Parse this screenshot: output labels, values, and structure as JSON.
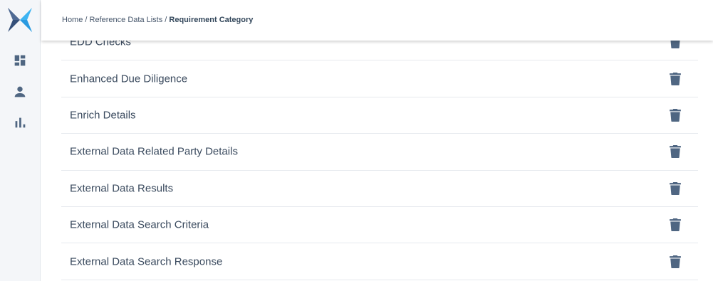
{
  "breadcrumb": {
    "home": "Home",
    "separator": " / ",
    "section": "Reference Data Lists",
    "current": "Requirement Category"
  },
  "sidebar": {
    "items": [
      {
        "icon": "dashboard-icon"
      },
      {
        "icon": "user-icon"
      },
      {
        "icon": "bar-chart-icon"
      }
    ]
  },
  "rows": [
    {
      "label": "EDD Checks"
    },
    {
      "label": "Enhanced Due Diligence"
    },
    {
      "label": "Enrich Details"
    },
    {
      "label": "External Data Related Party Details"
    },
    {
      "label": "External Data Results"
    },
    {
      "label": "External Data Search Criteria"
    },
    {
      "label": "External Data Search Response"
    }
  ],
  "colors": {
    "icon": "#4f6682",
    "logo_light": "#3db4f2",
    "logo_dark": "#35507a"
  }
}
